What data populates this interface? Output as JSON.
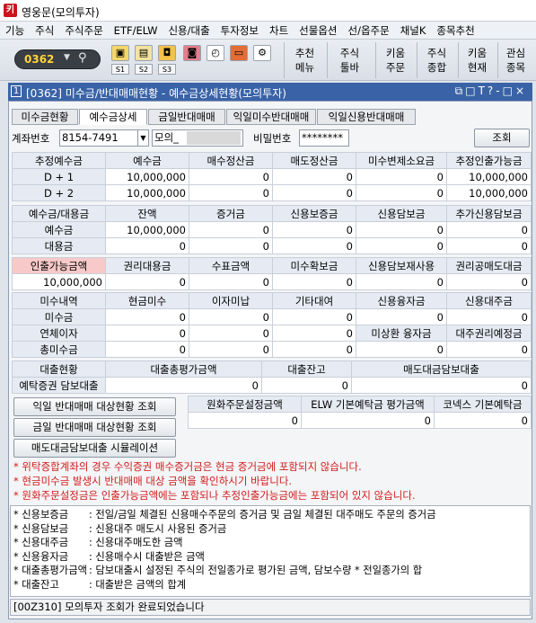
{
  "app": {
    "title": "영웅문(모의투자)",
    "icon_label": "키"
  },
  "menu": [
    "기능",
    "주식",
    "주식주문",
    "ETF/ELW",
    "신용/대출",
    "투자정보",
    "차트",
    "선물옵션",
    "선/옵주문",
    "채널K",
    "종목추천"
  ],
  "toolbar": {
    "screen_no": "0362",
    "dropdown": "▼",
    "slot_labels": [
      "S1",
      "S2",
      "S3"
    ],
    "buttons": [
      {
        "l1": "추천",
        "l2": "메뉴"
      },
      {
        "l1": "주식",
        "l2": "툴바"
      },
      {
        "l1": "키움",
        "l2": "주문"
      },
      {
        "l1": "주식",
        "l2": "종합"
      },
      {
        "l1": "키움",
        "l2": "현재"
      },
      {
        "l1": "관심",
        "l2": "종목"
      }
    ]
  },
  "window": {
    "num": "1",
    "title": "[0362] 미수금/반대매매현황 - 예수금상세현황(모의투자)",
    "controls": "⧉□T?-□×"
  },
  "tabs": [
    "미수금현황",
    "예수금상세",
    "금일반대매매",
    "익일미수반대매매",
    "익일신용반대매매"
  ],
  "account": {
    "label": "계좌번호",
    "value": "8154-7491",
    "name": "모의_",
    "pw_label": "비밀번호",
    "pw": "********",
    "search": "조회"
  },
  "grid1": {
    "headers": [
      "추정예수금",
      "예수금",
      "매수정산금",
      "매도정산금",
      "미수변제소요금",
      "추정인출가능금"
    ],
    "rows": [
      [
        "D + 1",
        "10,000,000",
        "0",
        "0",
        "0",
        "10,000,000"
      ],
      [
        "D + 2",
        "10,000,000",
        "0",
        "0",
        "0",
        "10,000,000"
      ]
    ]
  },
  "grid2": {
    "headers": [
      "예수금/대용금",
      "잔액",
      "증거금",
      "신용보증금",
      "신용담보금",
      "추가신용담보금"
    ],
    "rows": [
      [
        "예수금",
        "10,000,000",
        "0",
        "0",
        "0",
        "0"
      ],
      [
        "대용금",
        "0",
        "0",
        "0",
        "0",
        "0"
      ]
    ]
  },
  "grid3": {
    "headers": [
      "인출가능금액",
      "권리대용금",
      "수표금액",
      "미수확보금",
      "신용담보재사용",
      "권리공매도대금"
    ],
    "values": [
      "10,000,000",
      "0",
      "0",
      "0",
      "0",
      "0"
    ]
  },
  "grid4": {
    "headers": [
      "미수내역",
      "현금미수",
      "이자미납",
      "기타대여",
      "신용융자금",
      "신용대주금"
    ],
    "rows": [
      [
        "미수금",
        "0",
        "0",
        "0",
        "0",
        "0"
      ],
      [
        "연체이자",
        "0",
        "0",
        "0",
        "미상환 융자금",
        "대주권리예정금"
      ],
      [
        "총미수금",
        "0",
        "0",
        "0",
        "0",
        "0"
      ]
    ]
  },
  "grid5": {
    "headers": [
      "대출현황",
      "대출총평가금액",
      "대출잔고",
      "매도대금담보대출"
    ],
    "row": [
      "예탁증권 담보대출",
      "0",
      "0",
      "0"
    ]
  },
  "grid6": {
    "headers": [
      "원화주문설정금액",
      "ELW 기본예탁금 평가금액",
      "코넥스 기본예탁금"
    ],
    "values": [
      "0",
      "0",
      "0"
    ]
  },
  "actions": [
    "익일 반대매매 대상현황 조회",
    "금일 반대매매 대상현황 조회",
    "매도대금담보대출 시뮬레이션"
  ],
  "notes": [
    "* 위탁증합계좌의 경우 수익증권 매수증거금은 현금 증거금에 포함되지 않습니다.",
    "* 현금미수금 발생시 반대매매 대상 금액을 확인하시기 바랍니다.",
    "* 원화주문설정금은 인출가능금액에는 포함되나 추정인출가능금에는 포함되어 있지 않습니다."
  ],
  "legend": [
    {
      "t": "* 신용보증금",
      "d": ": 전일/금일 체결된 신용매수주문의 증거금 및 금일 체결된 대주매도 주문의 증거금"
    },
    {
      "t": "* 신용담보금",
      "d": ": 신용대주 매도시 사용된 증거금"
    },
    {
      "t": "* 신용대주금",
      "d": ": 신용대주매도한 금액"
    },
    {
      "t": "* 신용융자금",
      "d": ": 신용매수시 대출받은 금액"
    },
    {
      "t": "* 대출총평가금액",
      "d": ": 담보대출시 설정된 주식의 전일종가로 평가된 금액, 담보수량 * 전일종가의 합"
    },
    {
      "t": "* 대출잔고",
      "d": ": 대출받은 금액의 합계"
    }
  ],
  "status": "[00Z310] 모의투자 조회가 완료되었습니다",
  "colors": {
    "titlebar": "#3a63a7",
    "highlight": "#f7c9c9",
    "notes": "#d21c1c",
    "screen_no": "#ffd43a"
  }
}
